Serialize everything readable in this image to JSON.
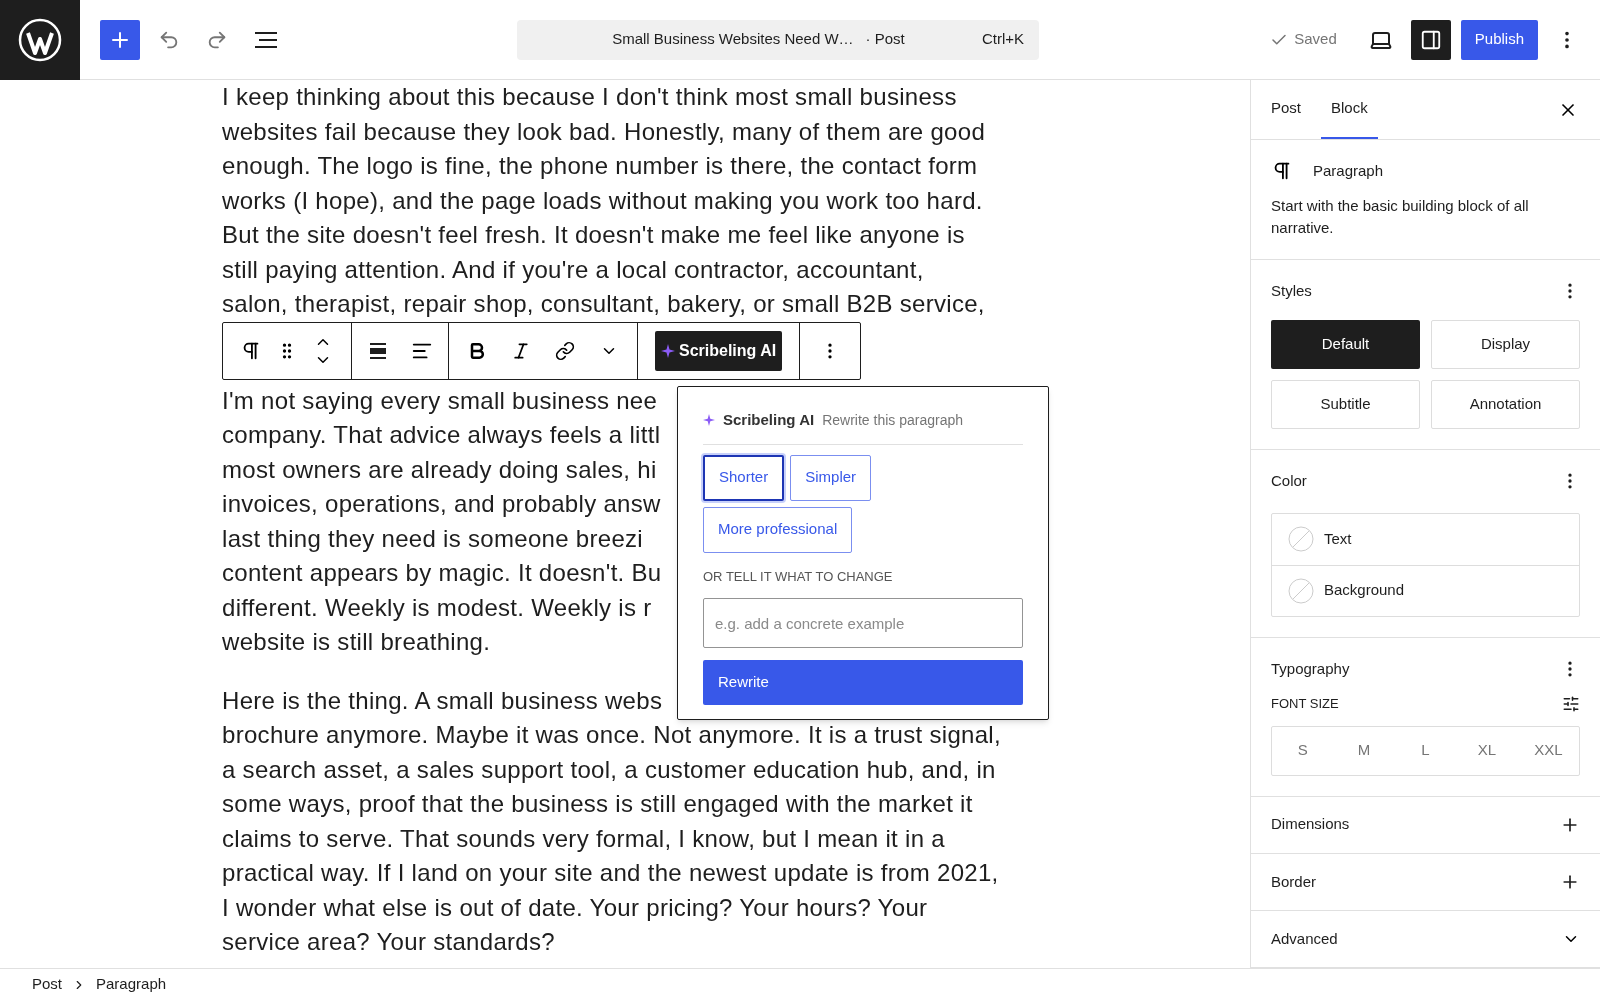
{
  "top_bar": {
    "document_title": "Small Business Websites Need W…",
    "document_type": "· Post",
    "shortcut": "Ctrl+K",
    "save_status": "Saved",
    "settings_open": true,
    "publish_label": "Publish"
  },
  "editor": {
    "paragraphs": [
      {
        "lines": [
          "I keep thinking about this because I don't think most small business",
          "websites fail because they look bad. Honestly, many of them are good",
          "enough. The logo is fine, the phone number is there, the contact form",
          "works (I hope), and the page loads without making you work too hard.",
          "But the site doesn't feel fresh. It doesn't make me feel like anyone is",
          "still paying attention. And if you're a local contractor, accountant,",
          "salon, therapist, repair shop, consultant, bakery, or small B2B service,"
        ]
      },
      {
        "lines": [
          "I'm not saying every small business nee",
          "company. That advice always feels a littl",
          "most owners are already doing sales, hi",
          "invoices, operations, and probably answ",
          "last thing they need is someone breezi",
          "content appears by magic. It doesn't. Bu",
          "different. Weekly is modest. Weekly is r",
          "website is still breathing."
        ]
      },
      {
        "lines": [
          "Here is the thing. A small business webs",
          "brochure anymore. Maybe it was once. Not anymore. It is a trust signal,",
          "a search asset, a sales support tool, a customer education hub, and, in",
          "some ways, proof that the business is still engaged with the market it",
          "claims to serve. That sounds very formal, I know, but I mean it in a",
          "practical way. If I land on your site and the newest update is from 2021,",
          "I wonder what else is out of date. Your pricing? Your hours? Your",
          "service area? Your standards?"
        ]
      }
    ]
  },
  "block_toolbar": {
    "ai_button": "Scribeling AI"
  },
  "ai_popover": {
    "title": "Scribeling AI",
    "subtitle": "Rewrite this paragraph",
    "options": [
      {
        "label": "Shorter",
        "selected": true
      },
      {
        "label": "Simpler",
        "selected": false
      },
      {
        "label": "More professional",
        "selected": false
      }
    ],
    "custom_label": "OR TELL IT WHAT TO CHANGE",
    "placeholder": "e.g. add a concrete example",
    "submit": "Rewrite"
  },
  "sidebar": {
    "tabs": [
      {
        "label": "Post",
        "selected": false
      },
      {
        "label": "Block",
        "selected": true
      }
    ],
    "block": {
      "name": "Paragraph",
      "description": "Start with the basic building block of all narrative."
    },
    "sections": [
      {
        "kind": "styles",
        "title": "Styles",
        "options": [
          {
            "label": "Default",
            "selected": true
          },
          {
            "label": "Display",
            "selected": false
          },
          {
            "label": "Subtitle",
            "selected": false
          },
          {
            "label": "Annotation",
            "selected": false
          }
        ]
      },
      {
        "kind": "color",
        "title": "Color",
        "items": [
          "Text",
          "Background"
        ]
      },
      {
        "kind": "typography",
        "title": "Typography",
        "label": "FONT SIZE",
        "sizes": [
          "S",
          "M",
          "L",
          "XL",
          "XXL"
        ]
      },
      {
        "kind": "addable",
        "title": "Dimensions"
      },
      {
        "kind": "addable",
        "title": "Border"
      },
      {
        "kind": "collapsible",
        "title": "Advanced",
        "expanded": false
      }
    ]
  },
  "breadcrumbs": [
    "Post",
    "Paragraph"
  ]
}
